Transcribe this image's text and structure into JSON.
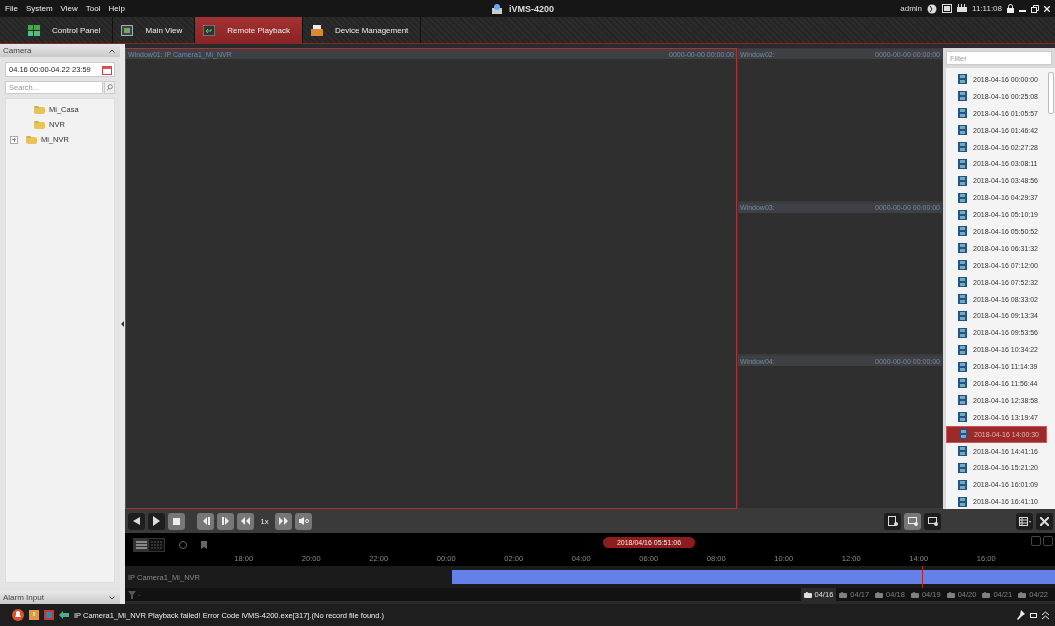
{
  "title_bar": {
    "menu": [
      "File",
      "System",
      "View",
      "Tool",
      "Help"
    ],
    "app_title": "iVMS-4200",
    "user": "admin",
    "time": "11:11:08"
  },
  "tabs": [
    {
      "label": "Control Panel",
      "selected": false
    },
    {
      "label": "Main View",
      "selected": false
    },
    {
      "label": "Remote Playback",
      "selected": true
    },
    {
      "label": "Device Management",
      "selected": false
    }
  ],
  "camera_panel": {
    "title": "Camera",
    "date_range": "04.16 00:00-04.22 23:59",
    "search": {
      "placeholder": "Search..."
    },
    "tree": [
      {
        "label": "Mi_Casa",
        "expandable": false
      },
      {
        "label": "NVR",
        "expandable": false
      },
      {
        "label": "Mi_NVR",
        "expandable": true
      }
    ],
    "footer": "Alarm Input"
  },
  "windows": [
    {
      "title": "Window01:",
      "camera": "IP Camera1_Mi_NVR",
      "timestamp": "0000-00-00 00:00:00",
      "selected": true
    },
    {
      "title": "Window02:",
      "timestamp": "0000-00-00 00:00:00",
      "selected": false
    },
    {
      "title": "Window03:",
      "timestamp": "0000-00-00 00:00:00",
      "selected": false
    },
    {
      "title": "Window04:",
      "timestamp": "0000-00-00 00:00:00",
      "selected": false
    }
  ],
  "controls": {
    "speed": "1x"
  },
  "timeline": {
    "current_time": "2018/04/16 05:51:06",
    "ticks": [
      "18:00",
      "20:00",
      "22:00",
      "00:00",
      "02:00",
      "04:00",
      "06:00",
      "08:00",
      "10:00",
      "12:00",
      "14:00",
      "16:00"
    ],
    "track_label": "IP Camera1_Mi_NVR",
    "filter_label": "-",
    "days": [
      {
        "label": "04/16",
        "selected": true
      },
      {
        "label": "04/17",
        "selected": false
      },
      {
        "label": "04/18",
        "selected": false
      },
      {
        "label": "04/19",
        "selected": false
      },
      {
        "label": "04/20",
        "selected": false
      },
      {
        "label": "04/21",
        "selected": false
      },
      {
        "label": "04/22",
        "selected": false
      }
    ]
  },
  "files": {
    "placeholder": "Filter",
    "items": [
      {
        "time": "2018-04-16 00:00:00",
        "selected": false
      },
      {
        "time": "2018-04-16 00:25:08",
        "selected": false
      },
      {
        "time": "2018-04-16 01:05:57",
        "selected": false
      },
      {
        "time": "2018-04-16 01:46:42",
        "selected": false
      },
      {
        "time": "2018-04-16 02:27:28",
        "selected": false
      },
      {
        "time": "2018-04-16 03:08:11",
        "selected": false
      },
      {
        "time": "2018-04-16 03:48:56",
        "selected": false
      },
      {
        "time": "2018-04-16 04:29:37",
        "selected": false
      },
      {
        "time": "2018-04-16 05:10:19",
        "selected": false
      },
      {
        "time": "2018-04-16 05:50:52",
        "selected": false
      },
      {
        "time": "2018-04-16 06:31:32",
        "selected": false
      },
      {
        "time": "2018-04-16 07:12:00",
        "selected": false
      },
      {
        "time": "2018-04-16 07:52:32",
        "selected": false
      },
      {
        "time": "2018-04-16 08:33:02",
        "selected": false
      },
      {
        "time": "2018-04-16 09:13:34",
        "selected": false
      },
      {
        "time": "2018-04-16 09:53:56",
        "selected": false
      },
      {
        "time": "2018-04-16 10:34:22",
        "selected": false
      },
      {
        "time": "2018-04-16 11:14:39",
        "selected": false
      },
      {
        "time": "2018-04-16 11:56:44",
        "selected": false
      },
      {
        "time": "2018-04-16 12:38:58",
        "selected": false
      },
      {
        "time": "2018-04-16 13:19:47",
        "selected": false
      },
      {
        "time": "2018-04-16 14:00:30",
        "selected": true
      },
      {
        "time": "2018-04-16 14:41:16",
        "selected": false
      },
      {
        "time": "2018-04-16 15:21:20",
        "selected": false
      },
      {
        "time": "2018-04-16 16:01:09",
        "selected": false
      },
      {
        "time": "2018-04-16 16:41:10",
        "selected": false
      }
    ]
  },
  "status_bar": {
    "message": "IP Camera1_Mi_NVR Playback failed! Error Code iVMS-4200.exe[317].(No record file found.)"
  }
}
